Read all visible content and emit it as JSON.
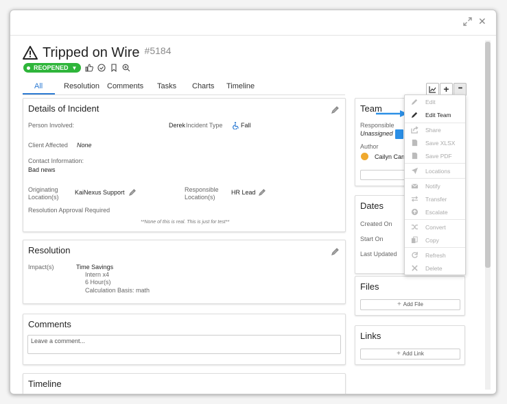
{
  "window": {
    "expand_icon": "expand-arrows-icon",
    "close_icon": "close-x-icon",
    "close_glyph": "✕"
  },
  "header": {
    "title": "Tripped on Wire",
    "id": "#5184",
    "status": "REOPENED",
    "status_color": "#2eb53a"
  },
  "tabs": [
    "All",
    "Resolution",
    "Comments",
    "Tasks",
    "Charts",
    "Timeline"
  ],
  "toolbar": {
    "plus": "+",
    "more": "•••"
  },
  "details": {
    "title": "Details of Incident",
    "person_involved_label": "Person Involved:",
    "person_involved_value": "Derek",
    "incident_type_label": "Incident Type",
    "incident_type_value": "Fall",
    "client_affected_label": "Client Affected",
    "client_affected_value": "None",
    "contact_label": "Contact Information:",
    "contact_value": "Bad news",
    "originating_label_1": "Originating",
    "originating_label_2": "Location(s)",
    "originating_value": "KaiNexus Support",
    "responsible_label_1": "Responsible",
    "responsible_label_2": "Location(s)",
    "responsible_value": "HR Lead",
    "approval_label": "Resolution Approval Required",
    "footnote": "**None of this is real. This is just for test**"
  },
  "resolution": {
    "title": "Resolution",
    "impacts_label": "Impact(s)",
    "impact_title": "Time Savings",
    "impact_lines": [
      "Intern x4",
      "6 Hour(s)",
      "Calculation Basis: math"
    ]
  },
  "comments": {
    "title": "Comments",
    "placeholder": "Leave a comment..."
  },
  "timeline": {
    "title": "Timeline"
  },
  "team": {
    "title": "Team",
    "responsible_label": "Responsible",
    "responsible_value": "Unassigned",
    "author_label": "Author",
    "author_value": "Cailyn Carr"
  },
  "dates": {
    "title": "Dates",
    "created": "Created On",
    "start": "Start On",
    "updated": "Last Updated"
  },
  "files": {
    "title": "Files",
    "add": "Add File"
  },
  "links": {
    "title": "Links",
    "add": "Add Link"
  },
  "menu": {
    "items": [
      "Edit",
      "Edit Team",
      "Share",
      "Save XLSX",
      "Save PDF",
      "Locations",
      "Notify",
      "Transfer",
      "Escalate",
      "Convert",
      "Copy",
      "Refresh",
      "Delete"
    ],
    "highlight_arrow_color": "#2b8fe6"
  }
}
